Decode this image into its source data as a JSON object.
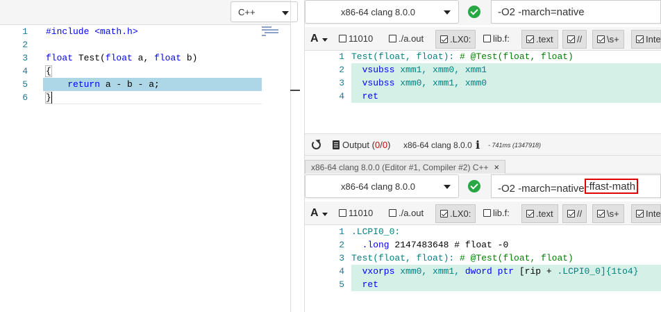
{
  "editor": {
    "language": "C++",
    "line_numbers": [
      "1",
      "2",
      "3",
      "4",
      "5",
      "6"
    ],
    "lines": [
      {
        "plain": "#include <math.h>"
      },
      {
        "plain": ""
      },
      {
        "kw1": "float",
        "mid": " Test(",
        "kw2": "float",
        "mid2": " a, ",
        "kw3": "float",
        "end": " b)"
      },
      {
        "plain": "{"
      },
      {
        "indent": "    ",
        "kw": "return",
        "rest": " a - b - a;"
      },
      {
        "plain": "}"
      }
    ]
  },
  "compiler1": {
    "compiler_name": "x86-64 clang 8.0.0",
    "flags": "-O2 -march=native",
    "filters": {
      "binary": "11010",
      "execute": "./a.out",
      "labels": ".LX0:",
      "libs": "lib.f:",
      "directives": ".text",
      "comments": "//",
      "whitespace": "\\s+",
      "intel": "Inte"
    },
    "asm": {
      "line_numbers": [
        "1",
        "2",
        "3",
        "4"
      ],
      "l1": {
        "label": "Test(float, float):",
        "comment": " # @Test(float, float)"
      },
      "l2": {
        "ins": "  vsubss",
        "ops": " xmm1, xmm0, xmm1"
      },
      "l3": {
        "ins": "  vsubss",
        "ops": " xmm0, xmm1, xmm0"
      },
      "l4": {
        "ins": "  ret"
      }
    },
    "status": {
      "output_label": "Output (",
      "output_count1": "0",
      "output_sep": "/",
      "output_count2": "0",
      "output_close": ")",
      "compiler_name": "x86-64 clang 8.0.0",
      "info": "i",
      "timing": "- 741ms (1347918)"
    }
  },
  "compiler2": {
    "tab_title": "x86-64 clang 8.0.0 (Editor #1, Compiler #2) C++",
    "tab_close": "×",
    "compiler_name": "x86-64 clang 8.0.0",
    "flags_base": "-O2 -march=native",
    "flags_extra": "-ffast-math",
    "filters": {
      "binary": "11010",
      "execute": "./a.out",
      "labels": ".LX0:",
      "libs": "lib.f:",
      "directives": ".text",
      "comments": "//",
      "whitespace": "\\s+",
      "intel": "Inte"
    },
    "asm": {
      "line_numbers": [
        "1",
        "2",
        "3",
        "4",
        "5"
      ],
      "l1": {
        "label": ".LCPI0_0:"
      },
      "l2": {
        "ins": "  .long",
        "num": " 2147483648",
        "comment": " # float -0"
      },
      "l3": {
        "label": "Test(float, float):",
        "comment": " # @Test(float, float)"
      },
      "l4": {
        "ins": "  vxorps",
        "ops": " xmm0, xmm1, ",
        "kw": "dword ptr",
        "mem1": " [rip + ",
        "lbl": ".LCPI0_0",
        "mem2": "]{1to4}"
      },
      "l5": {
        "ins": "  ret"
      }
    }
  },
  "colors": {
    "accent_highlight": "#add6e6",
    "asm_highlight": "#d5f0e6",
    "success": "#28a745",
    "annotation_red": "#dd0000"
  }
}
